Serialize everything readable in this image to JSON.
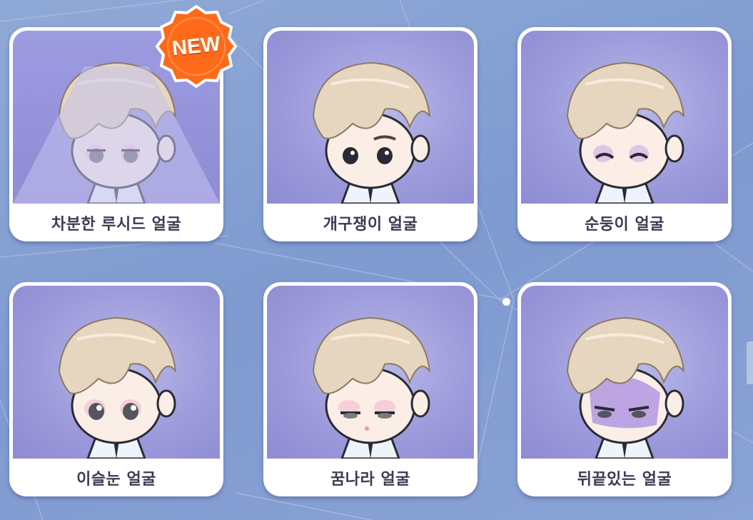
{
  "badge": {
    "text": "NEW",
    "color": "#ff6a1a"
  },
  "faces": [
    {
      "label": "차분한 루시드 얼굴",
      "is_new": true,
      "variant": "calm"
    },
    {
      "label": "개구쟁이 얼굴",
      "is_new": false,
      "variant": "mischief"
    },
    {
      "label": "순둥이 얼굴",
      "is_new": false,
      "variant": "gentle"
    },
    {
      "label": "이슬눈 얼굴",
      "is_new": false,
      "variant": "dewy"
    },
    {
      "label": "꿈나라 얼굴",
      "is_new": false,
      "variant": "sleepy"
    },
    {
      "label": "뒤끝있는 얼굴",
      "is_new": false,
      "variant": "grudge"
    }
  ],
  "colors": {
    "background": "#8aa3d6",
    "card_art": "#9d9bdb",
    "label_text": "#3b3b52",
    "hair": "#e6d6bf",
    "skin": "#fbeee6"
  },
  "icons": [
    "new-badge-icon",
    "character-portrait-icon"
  ]
}
